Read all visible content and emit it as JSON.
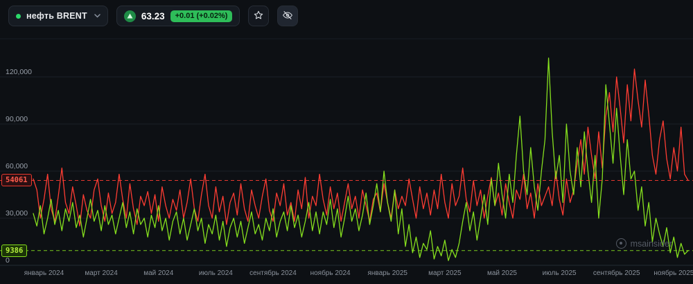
{
  "toolbar": {
    "symbol": "нефть BRENT",
    "price": "63.23",
    "change": "+0.01 (+0.02%)"
  },
  "watermark": {
    "text": "msainsider"
  },
  "chart_data": {
    "type": "line",
    "title": "",
    "xlabel": "",
    "ylabel": "",
    "ylim": [
      0,
      135000
    ],
    "grid": true,
    "legend": "none",
    "x_labels": [
      "январь 2024",
      "март 2024",
      "май 2024",
      "июль 2024",
      "сентябрь 2024",
      "ноябрь 2024",
      "январь 2025",
      "март 2025",
      "май 2025",
      "июль 2025",
      "сентябрь 2025",
      "ноябрь 2025"
    ],
    "y_ticks": [
      {
        "value": 0,
        "label": "0"
      },
      {
        "value": 30000,
        "label": "30,000"
      },
      {
        "value": 60000,
        "label": "60,000"
      },
      {
        "value": 90000,
        "label": "90,000"
      },
      {
        "value": 120000,
        "label": "120,000"
      }
    ],
    "reference_lines": [
      {
        "value": 54061,
        "label": "54061",
        "color": "#ff3d33"
      },
      {
        "value": 9386,
        "label": "9386",
        "color": "#86e01e"
      }
    ],
    "series": [
      {
        "name": "series-red",
        "color": "#ff3d33",
        "values": [
          55000,
          48000,
          30000,
          42000,
          58000,
          36000,
          28000,
          44000,
          62000,
          40000,
          33000,
          50000,
          38000,
          25000,
          45000,
          35000,
          30000,
          48000,
          55000,
          38000,
          28000,
          46000,
          33000,
          40000,
          58000,
          42000,
          30000,
          52000,
          36000,
          26000,
          44000,
          38000,
          47000,
          33000,
          45000,
          28000,
          50000,
          38000,
          30000,
          42000,
          35000,
          48000,
          30000,
          40000,
          55000,
          36000,
          28000,
          45000,
          58000,
          38000,
          30000,
          50000,
          34000,
          44000,
          26000,
          40000,
          46000,
          32000,
          52000,
          36000,
          28000,
          48000,
          38000,
          30000,
          44000,
          55000,
          35000,
          28000,
          46000,
          38000,
          52000,
          32000,
          40000,
          28000,
          48000,
          36000,
          56000,
          30000,
          44000,
          38000,
          58000,
          42000,
          32000,
          50000,
          36000,
          46000,
          28000,
          40000,
          52000,
          36000,
          44000,
          30000,
          48000,
          38000,
          28000,
          42000,
          46000,
          34000,
          52000,
          40000,
          30000,
          48000,
          36000,
          44000,
          38000,
          55000,
          42000,
          30000,
          50000,
          36000,
          46000,
          32000,
          48000,
          36000,
          58000,
          40000,
          30000,
          52000,
          38000,
          44000,
          62000,
          42000,
          34000,
          54000,
          38000,
          48000,
          30000,
          44000,
          56000,
          38000,
          46000,
          32000,
          52000,
          40000,
          30000,
          48000,
          42000,
          58000,
          36000,
          46000,
          30000,
          52000,
          38000,
          44000,
          50000,
          38000,
          60000,
          42000,
          32000,
          55000,
          40000,
          48000,
          65000,
          80000,
          58000,
          88000,
          70000,
          55000,
          85000,
          62000,
          95000,
          110000,
          85000,
          120000,
          100000,
          78000,
          115000,
          92000,
          125000,
          105000,
          88000,
          118000,
          96000,
          70000,
          58000,
          80000,
          92000,
          68000,
          55000,
          75000,
          60000,
          88000,
          58000,
          54061
        ]
      },
      {
        "name": "series-green",
        "color": "#86e01e",
        "values": [
          33000,
          25000,
          38000,
          20000,
          30000,
          42000,
          26000,
          35000,
          22000,
          36000,
          28000,
          40000,
          24000,
          32000,
          18000,
          30000,
          42000,
          28000,
          35000,
          22000,
          38000,
          26000,
          32000,
          20000,
          30000,
          40000,
          24000,
          34000,
          20000,
          36000,
          26000,
          30000,
          18000,
          32000,
          24000,
          38000,
          22000,
          30000,
          16000,
          28000,
          34000,
          20000,
          30000,
          16000,
          26000,
          36000,
          22000,
          30000,
          14000,
          26000,
          20000,
          32000,
          16000,
          28000,
          12000,
          24000,
          30000,
          18000,
          28000,
          14000,
          24000,
          34000,
          20000,
          26000,
          16000,
          30000,
          22000,
          36000,
          18000,
          28000,
          34000,
          22000,
          38000,
          24000,
          32000,
          18000,
          28000,
          40000,
          22000,
          34000,
          20000,
          34000,
          26000,
          42000,
          24000,
          36000,
          18000,
          30000,
          44000,
          28000,
          36000,
          22000,
          32000,
          46000,
          26000,
          38000,
          52000,
          34000,
          60000,
          40000,
          28000,
          48000,
          20000,
          36000,
          12000,
          26000,
          8000,
          18000,
          5000,
          14000,
          10000,
          22000,
          4000,
          12000,
          6000,
          16000,
          3000,
          10000,
          5000,
          14000,
          28000,
          40000,
          22000,
          34000,
          16000,
          30000,
          45000,
          26000,
          55000,
          38000,
          65000,
          45000,
          30000,
          58000,
          40000,
          70000,
          95000,
          60000,
          45000,
          75000,
          50000,
          35000,
          60000,
          80000,
          132000,
          85000,
          55000,
          70000,
          40000,
          90000,
          60000,
          45000,
          75000,
          50000,
          85000,
          60000,
          40000,
          70000,
          30000,
          55000,
          115000,
          90000,
          65000,
          100000,
          70000,
          45000,
          80000,
          55000,
          60000,
          35000,
          50000,
          25000,
          40000,
          15000,
          30000,
          20000,
          12000,
          24000,
          8000,
          18000,
          5000,
          14000,
          7000,
          9386
        ]
      }
    ]
  }
}
